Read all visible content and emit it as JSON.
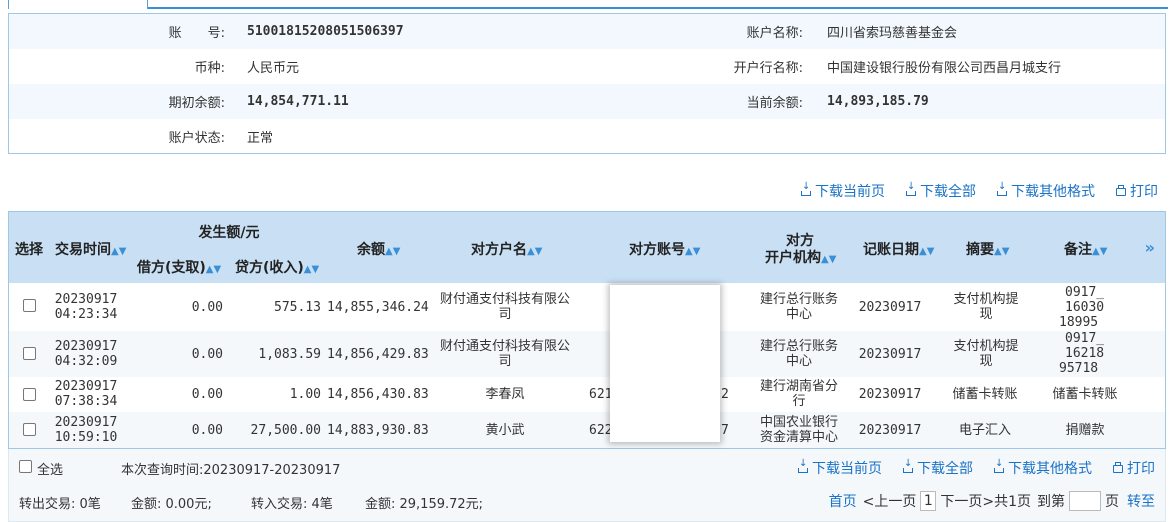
{
  "account": {
    "number_label": "账　　号:",
    "number": "51001815208051506397",
    "name_label": "账户名称:",
    "name": "四川省索玛慈善基金会",
    "currency_label": "币种:",
    "currency": "人民币元",
    "bank_label": "开户行名称:",
    "bank": "中国建设银行股份有限公司西昌月城支行",
    "opening_label": "期初余额:",
    "opening": "14,854,771.11",
    "current_label": "当前余额:",
    "current": "14,893,185.79",
    "status_label": "账户状态:",
    "status": "正常"
  },
  "actions": {
    "download_page": "下载当前页",
    "download_all": "下载全部",
    "download_other": "下载其他格式",
    "print": "打印"
  },
  "table": {
    "headers": {
      "select": "选择",
      "time": "交易时间",
      "amount_group": "发生额/元",
      "debit": "借方(支取)",
      "credit": "贷方(收入)",
      "balance": "余额",
      "cp_name": "对方户名",
      "cp_account": "对方账号",
      "cp_bank_1": "对方",
      "cp_bank_2": "开户机构",
      "post_date": "记账日期",
      "summary": "摘要",
      "remark": "备注",
      "more": "»"
    },
    "rows": [
      {
        "time1": "20230917",
        "time2": "04:23:34",
        "debit": "0.00",
        "credit": "575.13",
        "balance": "14,855,346.24",
        "cp_name1": "财付通支付科技有限公",
        "cp_name2": "司",
        "cp_account": "",
        "cp_bank1": "建行总行账务",
        "cp_bank2": "中心",
        "post_date": "20230917",
        "summary1": "支付机构提",
        "summary2": "现",
        "remark1": "0917_",
        "remark2": "16030",
        "remark3": "18995"
      },
      {
        "time1": "20230917",
        "time2": "04:32:09",
        "debit": "0.00",
        "credit": "1,083.59",
        "balance": "14,856,429.83",
        "cp_name1": "财付通支付科技有限公",
        "cp_name2": "司",
        "cp_account": "",
        "cp_bank1": "建行总行账务",
        "cp_bank2": "中心",
        "post_date": "20230917",
        "summary1": "支付机构提",
        "summary2": "现",
        "remark1": "0917_",
        "remark2": "16218",
        "remark3": "95718"
      },
      {
        "time1": "20230917",
        "time2": "07:38:34",
        "debit": "0.00",
        "credit": "1.00",
        "balance": "14,856,430.83",
        "cp_name1": "李春凤",
        "cp_name2": "",
        "cp_account": "621",
        "cp_account_tail": "2",
        "cp_bank1": "建行湖南省分",
        "cp_bank2": "行",
        "post_date": "20230917",
        "summary1": "储蓄卡转账",
        "summary2": "",
        "remark1": "储蓄卡转账",
        "remark2": "",
        "remark3": ""
      },
      {
        "time1": "20230917",
        "time2": "10:59:10",
        "debit": "0.00",
        "credit": "27,500.00",
        "balance": "14,883,930.83",
        "cp_name1": "黄小武",
        "cp_name2": "",
        "cp_account": "622",
        "cp_account_tail": "7",
        "cp_bank1": "中国农业银行",
        "cp_bank2": "资金清算中心",
        "post_date": "20230917",
        "summary1": "电子汇入",
        "summary2": "",
        "remark1": "捐赠款",
        "remark2": "",
        "remark3": ""
      }
    ]
  },
  "footer": {
    "select_all": "全选",
    "query_time": "本次查询时间:20230917-20230917",
    "out_trans": "转出交易: 0笔",
    "out_amount": "金额: 0.00元;",
    "in_trans": "转入交易: 4笔",
    "in_amount": "金额: 29,159.72元;",
    "first": "首页",
    "prev": "<上一页",
    "page": "1",
    "next": "下一页>",
    "total": "共1页",
    "goto": "到第",
    "page_unit": "页",
    "go": "转至"
  }
}
